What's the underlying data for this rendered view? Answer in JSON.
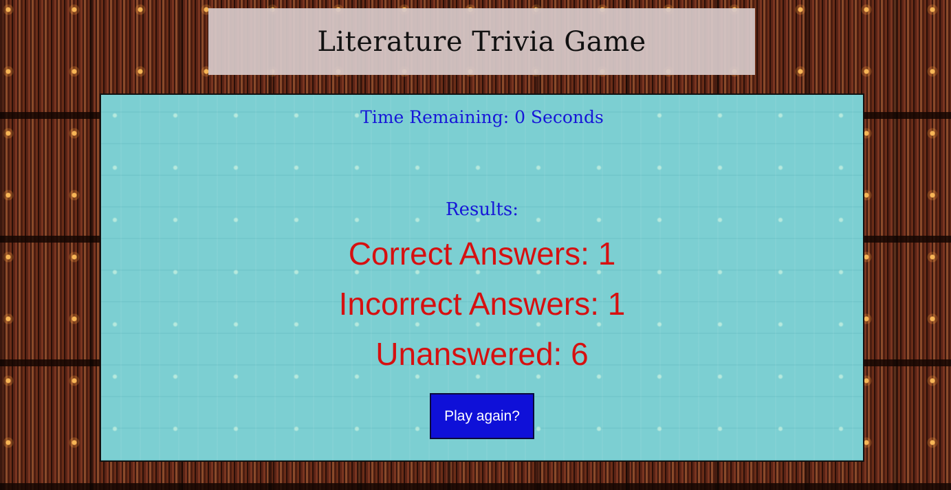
{
  "header": {
    "title": "Literature Trivia Game"
  },
  "game": {
    "timer_text": "Time Remaining: 0 Seconds",
    "results_label": "Results:",
    "correct_text": "Correct Answers: 1",
    "incorrect_text": "Incorrect Answers: 1",
    "unanswered_text": "Unanswered: 6",
    "play_again_label": "Play again?"
  },
  "colors": {
    "title_bar_bg": "#d6c8c8",
    "panel_bg": "#7ccfd2",
    "timer_text": "#1616d8",
    "stat_text": "#d61010",
    "button_bg": "#0f10d8",
    "button_text": "#ffffff"
  }
}
